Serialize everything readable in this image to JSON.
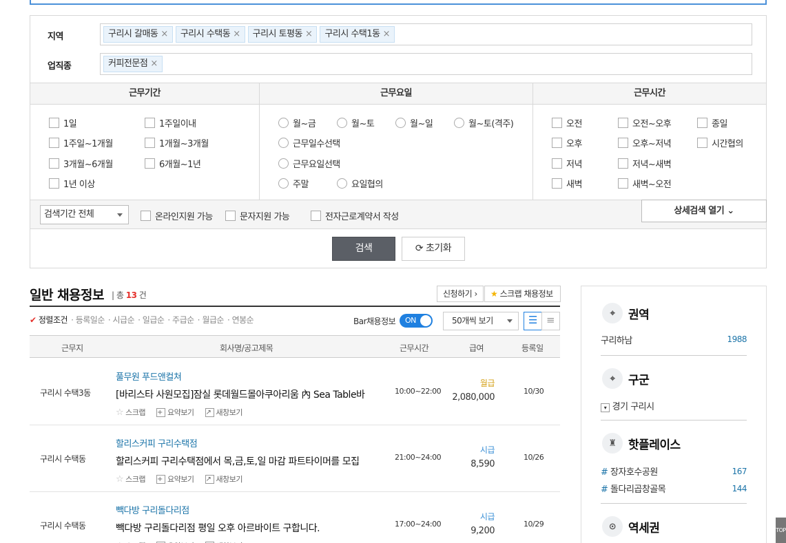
{
  "filters": {
    "region_label": "지역",
    "region_tags": [
      "구리시 갈매동",
      "구리시 수택동",
      "구리시 토평동",
      "구리시 수택1동"
    ],
    "industry_label": "업직종",
    "industry_tags": [
      "커피전문점"
    ],
    "tag_remove_glyph": "×",
    "period_header": "근무기간",
    "day_header": "근무요일",
    "time_header": "근무시간",
    "period_options": [
      "1일",
      "1주일이내",
      "1주일~1개월",
      "1개월~3개월",
      "3개월~6개월",
      "6개월~1년",
      "1년 이상"
    ],
    "day_options": [
      "월~금",
      "월~토",
      "월~일",
      "월~토(격주)",
      "근무일수선택",
      "근무요일선택",
      "주말",
      "요일협의"
    ],
    "time_options": [
      "오전",
      "오전~오후",
      "종일",
      "오후",
      "오후~저녁",
      "시간협의",
      "저녁",
      "저녁~새벽",
      "새벽",
      "새벽~오전"
    ],
    "search_period_select": "검색기간 전체",
    "extra_options": [
      "온라인지원 가능",
      "문자지원 가능",
      "전자근로계약서 작성"
    ],
    "detail_search": "상세검색 열기",
    "search_button": "검색",
    "reset_button": "초기화"
  },
  "list": {
    "title": "일반 채용정보",
    "count_prefix": "총",
    "count": "13",
    "count_suffix": "건",
    "apply_button": "신청하기",
    "scrap_button": "스크랩 채용정보",
    "sort_options": [
      "정렬조건",
      "등록일순",
      "시급순",
      "일급순",
      "주급순",
      "월급순",
      "연봉순"
    ],
    "bar_label": "Bar채용정보",
    "toggle_label": "ON",
    "view_count": "50개씩 보기",
    "columns": [
      "근무지",
      "회사명/공고제목",
      "근무시간",
      "급여",
      "등록일"
    ],
    "action_labels": [
      "스크랩",
      "요약보기",
      "새창보기"
    ],
    "jobs": [
      {
        "location": "구리시 수택3동",
        "company": "풀무원 푸드앤컬쳐",
        "title": "[바리스타 사원모집]잠실 롯데월드몰아쿠아리움 內 Sea Table바",
        "time": "10:00~22:00",
        "pay_type": "월급",
        "pay_amount": "2,080,000",
        "date": "10/30"
      },
      {
        "location": "구리시 수택동",
        "company": "할리스커피 구리수택점",
        "title": "할리스커피 구리수택점에서 목,금,토,일 마감 파트타이머를 모집",
        "time": "21:00~24:00",
        "pay_type": "시급",
        "pay_amount": "8,590",
        "date": "10/26"
      },
      {
        "location": "구리시 수택동",
        "company": "빽다방 구리돌다리점",
        "title": "빽다방 구리돌다리점 평일 오후 아르바이트 구합니다.",
        "time": "17:00~24:00",
        "pay_type": "시급",
        "pay_amount": "9,200",
        "date": "10/29"
      }
    ]
  },
  "sidebar": {
    "area_title": "권역",
    "area_item": "구리하남",
    "area_count": "1988",
    "district_title": "구군",
    "district_item": "경기 구리시",
    "hot_title": "핫플레이스",
    "hot_items": [
      {
        "name": "장자호수공원",
        "count": "167"
      },
      {
        "name": "돌다리곱창골목",
        "count": "144"
      }
    ],
    "station_title": "역세권",
    "top_button": "TOP"
  },
  "colors": {
    "accent_blue": "#1f80e0",
    "pay_monthly": "#d4a017",
    "pay_hourly": "#3a8fd6",
    "count_red": "#e5322d"
  }
}
